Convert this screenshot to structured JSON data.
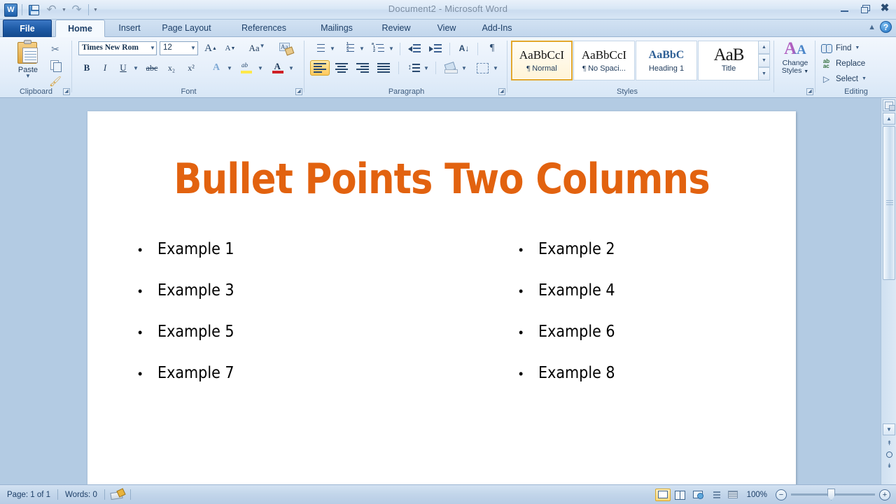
{
  "window": {
    "title": "Document2  -  Microsoft Word",
    "minimize_label": "Minimize",
    "restore_label": "Restore Down",
    "close_label": "Close",
    "help_label": "?",
    "collapse_ribbon_label": "Minimize the Ribbon"
  },
  "quick_access": {
    "app_logo": "W",
    "items": [
      {
        "name": "save",
        "icon": "save-icon",
        "label": "Save"
      },
      {
        "name": "undo",
        "icon": "undo-icon",
        "label": "Undo"
      },
      {
        "name": "redo",
        "icon": "redo-icon",
        "label": "Repeat"
      },
      {
        "name": "customize",
        "icon": "chevron-down-icon",
        "label": "Customize Quick Access Toolbar"
      }
    ]
  },
  "tabs": [
    {
      "id": "file",
      "label": "File",
      "active": false
    },
    {
      "id": "home",
      "label": "Home",
      "active": true
    },
    {
      "id": "insert",
      "label": "Insert",
      "active": false
    },
    {
      "id": "page-layout",
      "label": "Page Layout",
      "active": false
    },
    {
      "id": "references",
      "label": "References",
      "active": false
    },
    {
      "id": "mailings",
      "label": "Mailings",
      "active": false
    },
    {
      "id": "review",
      "label": "Review",
      "active": false
    },
    {
      "id": "view",
      "label": "View",
      "active": false
    },
    {
      "id": "add-ins",
      "label": "Add-Ins",
      "active": false
    }
  ],
  "ribbon": {
    "clipboard": {
      "group_label": "Clipboard",
      "paste_label": "Paste",
      "cut_label": "Cut",
      "copy_label": "Copy",
      "format_painter_label": "Format Painter",
      "cut_glyph": "✂"
    },
    "font": {
      "group_label": "Font",
      "font_name": "Times New Rom",
      "font_size": "12",
      "grow_font": "A",
      "shrink_font": "A",
      "change_case": "Aa",
      "clear_formatting_label": "Clear Formatting",
      "bold": "B",
      "italic": "I",
      "underline": "U",
      "strikethrough": "abc",
      "subscript": "x₂",
      "superscript": "x²",
      "text_effects": "A",
      "highlight_label": "Text Highlight Color",
      "font_color_label": "Font Color",
      "font_color_hex": "#cf2026",
      "highlight_color_hex": "#ffe84a"
    },
    "paragraph": {
      "group_label": "Paragraph",
      "bullets_label": "Bullets",
      "numbering_label": "Numbering",
      "multilevel_label": "Multilevel List",
      "decrease_indent_label": "Decrease Indent",
      "increase_indent_label": "Increase Indent",
      "sort_label": "Sort",
      "sort_glyph": "A↓",
      "show_marks_glyph": "¶",
      "align_left_label": "Align Text Left",
      "align_center_label": "Center",
      "align_right_label": "Align Text Right",
      "justify_label": "Justify",
      "line_spacing_label": "Line and Paragraph Spacing",
      "shading_label": "Shading",
      "borders_label": "Borders",
      "active_alignment": "align-left"
    },
    "styles": {
      "group_label": "Styles",
      "items": [
        {
          "sample": "AaBbCcI",
          "name": "Normal",
          "pilcrow": "¶",
          "selected": true,
          "kind": "normal"
        },
        {
          "sample": "AaBbCcI",
          "name": "No Spaci...",
          "pilcrow": "¶",
          "selected": false,
          "kind": "normal"
        },
        {
          "sample": "AaBbC",
          "name": "Heading 1",
          "pilcrow": "",
          "selected": false,
          "kind": "heading"
        },
        {
          "sample": "AaB",
          "name": "Title",
          "pilcrow": "",
          "selected": false,
          "kind": "title"
        }
      ],
      "scroll_up": "▲",
      "scroll_down": "▼",
      "more": "▼"
    },
    "change_styles": {
      "icon_text": "A",
      "line1": "Change",
      "line2": "Styles"
    },
    "editing": {
      "group_label": "Editing",
      "items": [
        {
          "name": "find",
          "label": "Find",
          "icon": "binoculars-icon",
          "has_caret": true
        },
        {
          "name": "replace",
          "label": "Replace",
          "icon": "replace-icon",
          "has_caret": false
        },
        {
          "name": "select",
          "label": "Select",
          "icon": "cursor-arrow-icon",
          "has_caret": true
        }
      ]
    }
  },
  "document": {
    "title_text": "Bullet Points Two Columns",
    "title_color": "#e2620f",
    "bullet_glyph": "•",
    "left_column": [
      "Example 1",
      "Example 3",
      "Example 5",
      "Example 7"
    ],
    "right_column": [
      "Example 2",
      "Example 4",
      "Example 6",
      "Example 8"
    ]
  },
  "status_bar": {
    "page_info": "Page: 1 of 1",
    "word_count": "Words: 0",
    "proofing_label": "Proofing errors",
    "zoom_level": "100%",
    "zoom_out": "−",
    "zoom_in": "+",
    "views": [
      {
        "name": "print-layout",
        "label": "Print Layout",
        "selected": true
      },
      {
        "name": "full-screen-reading",
        "label": "Full Screen Reading",
        "selected": false
      },
      {
        "name": "web-layout",
        "label": "Web Layout",
        "selected": false
      },
      {
        "name": "outline",
        "label": "Outline",
        "selected": false
      },
      {
        "name": "draft",
        "label": "Draft",
        "selected": false
      }
    ]
  },
  "scrollbar": {
    "up_arrow": "▲",
    "down_arrow": "▼",
    "browse_prev": "↑",
    "browse_object": "○",
    "browse_next": "↓",
    "split_label": "Split window"
  }
}
